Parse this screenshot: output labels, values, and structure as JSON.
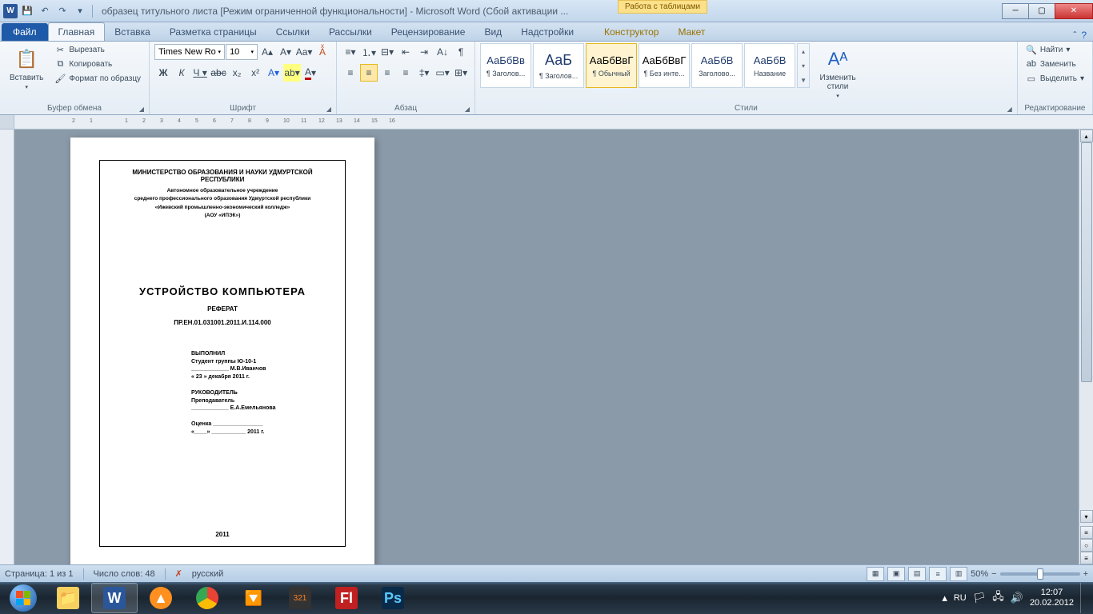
{
  "title": "образец титульного листа [Режим ограниченной функциональности]  -  Microsoft Word  (Сбой активации ...",
  "table_tools": "Работа с таблицами",
  "tabs": {
    "file": "Файл",
    "home": "Главная",
    "insert": "Вставка",
    "layout": "Разметка страницы",
    "references": "Ссылки",
    "mailings": "Рассылки",
    "review": "Рецензирование",
    "view": "Вид",
    "addins": "Надстройки",
    "design": "Конструктор",
    "tlayout": "Макет"
  },
  "clipboard": {
    "paste": "Вставить",
    "cut": "Вырезать",
    "copy": "Копировать",
    "format": "Формат по образцу",
    "label": "Буфер обмена"
  },
  "font": {
    "name": "Times New Ro",
    "size": "10",
    "label": "Шрифт"
  },
  "paragraph": {
    "label": "Абзац"
  },
  "styles": {
    "label": "Стили",
    "items": [
      {
        "preview": "АаБбВв",
        "name": "¶ Заголов..."
      },
      {
        "preview": "АаБ",
        "name": "¶ Заголов..."
      },
      {
        "preview": "АаБбВвГ",
        "name": "¶ Обычный"
      },
      {
        "preview": "АаБбВвГ",
        "name": "¶ Без инте..."
      },
      {
        "preview": "АаБбВ",
        "name": "Заголово..."
      },
      {
        "preview": "АаБбВ",
        "name": "Название"
      }
    ],
    "change": "Изменить стили"
  },
  "editing": {
    "find": "Найти",
    "replace": "Заменить",
    "select": "Выделить",
    "label": "Редактирование"
  },
  "document": {
    "ministry": "МИНИСТЕРСТВО ОБРАЗОВАНИЯ И НАУКИ УДМУРТСКОЙ РЕСПУБЛИКИ",
    "inst1": "Автономное образовательное учреждение",
    "inst2": "среднего профессионального образования Удмуртской республики",
    "inst3": "«Ижевский промышленно-экономический   колледж»",
    "inst4": "(АОУ «ИПЭК»)",
    "title": "УСТРОЙСТВО  КОМПЬЮТЕРА",
    "type": "РЕФЕРАТ",
    "code": "ПР.ЕН.01.031001.2011.И.114.000",
    "author_head": "ВЫПОЛНИЛ",
    "author_line1": "Студент группы Ю-10-1",
    "author_line2": "____________ М.В.Иванчов",
    "author_date": "« 23 »  декабря 2011 г.",
    "super_head": "РУКОВОДИТЕЛЬ",
    "super_line1": "Преподаватель",
    "super_line2": "____________ Е.А.Емельянова",
    "grade": "Оценка ________________",
    "grade_date": "«____» ___________ 2011 г.",
    "year": "2011"
  },
  "status": {
    "page": "Страница: 1 из 1",
    "words": "Число слов: 48",
    "lang": "русский",
    "zoom": "50%"
  },
  "tray": {
    "lang": "RU",
    "time": "12:07",
    "date": "20.02.2012"
  },
  "ruler_marks": [
    "2",
    "1",
    "",
    "1",
    "2",
    "3",
    "4",
    "5",
    "6",
    "7",
    "8",
    "9",
    "10",
    "11",
    "12",
    "13",
    "14",
    "15",
    "16"
  ]
}
